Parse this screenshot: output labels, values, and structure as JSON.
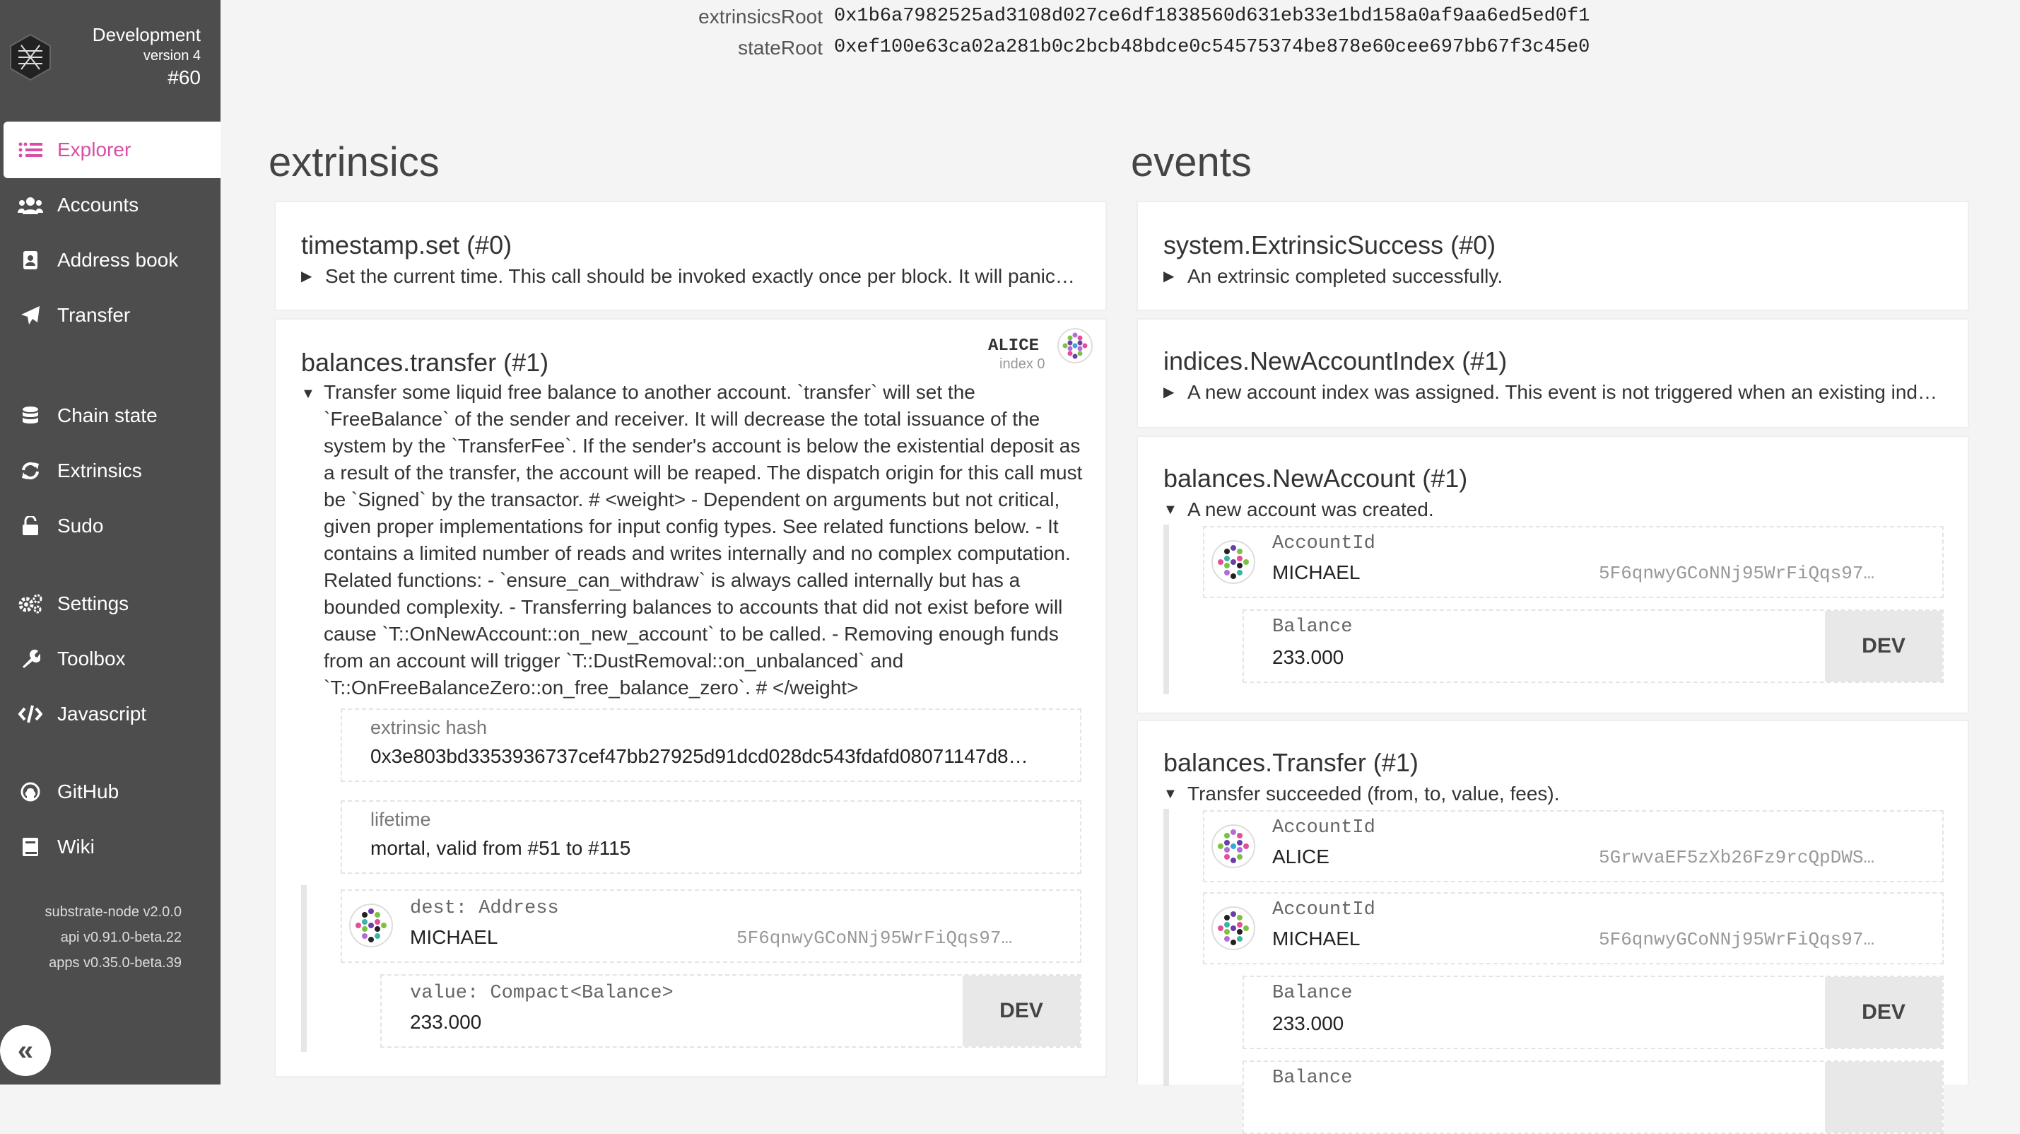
{
  "chain": {
    "name": "Development",
    "version": "version 4",
    "block": "#60"
  },
  "nav": [
    {
      "label": "Explorer",
      "icon": "explorer-grid-icon",
      "active": true
    },
    {
      "label": "Accounts",
      "icon": "users-icon"
    },
    {
      "label": "Address book",
      "icon": "address-book-icon"
    },
    {
      "label": "Transfer",
      "icon": "paper-plane-icon"
    },
    {
      "label": "Chain state",
      "icon": "database-icon"
    },
    {
      "label": "Extrinsics",
      "icon": "sync-icon"
    },
    {
      "label": "Sudo",
      "icon": "unlock-icon"
    },
    {
      "label": "Settings",
      "icon": "gears-icon"
    },
    {
      "label": "Toolbox",
      "icon": "wrench-icon"
    },
    {
      "label": "Javascript",
      "icon": "code-icon"
    },
    {
      "label": "GitHub",
      "icon": "github-icon"
    },
    {
      "label": "Wiki",
      "icon": "book-icon"
    }
  ],
  "versions": [
    "substrate-node v2.0.0",
    "api v0.91.0-beta.22",
    "apps v0.35.0-beta.39"
  ],
  "roots": {
    "extrinsics_label": "extrinsicsRoot",
    "extrinsics_value": "0x1b6a7982525ad3108d027ce6df1838560d631eb33e1bd158a0af9aa6ed5ed0f1",
    "state_label": "stateRoot",
    "state_value": "0xef100e63ca02a281b0c2bcb48bdce0c54575374be878e60cee697bb67f3c45e0"
  },
  "extrinsics": {
    "title": "extrinsics",
    "timestamp": {
      "title": "timestamp.set (#0)",
      "desc": "Set the current time. This call should be invoked exactly once per block. It will panic…"
    },
    "transfer": {
      "title": "balances.transfer (#1)",
      "signer_name": "ALICE",
      "signer_index": "index 0",
      "desc": "Transfer some liquid free balance to another account. `transfer` will set the `FreeBalance` of the sender and receiver. It will decrease the total issuance of the system by the `TransferFee`. If the sender's account is below the existential deposit as a result of the transfer, the account will be reaped. The dispatch origin for this call must be `Signed` by the transactor. # <weight> - Dependent on arguments but not critical, given proper implementations for input config types. See related functions below. - It contains a limited number of reads and writes internally and no complex computation. Related functions: - `ensure_can_withdraw` is always called internally but has a bounded complexity. - Transferring balances to accounts that did not exist before will cause `T::OnNewAccount::on_new_account` to be called. - Removing enough funds from an account will trigger `T::DustRemoval::on_unbalanced` and `T::OnFreeBalanceZero::on_free_balance_zero`. # </weight>",
      "hash_label": "extrinsic hash",
      "hash_value": "0x3e803bd3353936737cef47bb27925d91dcd028dc543fdafd08071147d8…",
      "lifetime_label": "lifetime",
      "lifetime_value": "mortal, valid from #51 to #115",
      "dest_label": "dest: Address",
      "dest_name": "MICHAEL",
      "dest_addr": "5F6qnwyGCoNNj95WrFiQqs97…",
      "value_label": "value: Compact<Balance>",
      "value_value": "233.000",
      "value_unit": "DEV"
    }
  },
  "events": {
    "title": "events",
    "success": {
      "title": "system.ExtrinsicSuccess (#0)",
      "desc": "An extrinsic completed successfully."
    },
    "newindex": {
      "title": "indices.NewAccountIndex (#1)",
      "desc": "A new account index was assigned. This event is not triggered when an existing ind…"
    },
    "newaccount": {
      "title": "balances.NewAccount (#1)",
      "desc": "A new account was created.",
      "acct_label": "AccountId",
      "acct_name": "MICHAEL",
      "acct_addr": "5F6qnwyGCoNNj95WrFiQqs97…",
      "bal_label": "Balance",
      "bal_value": "233.000",
      "bal_unit": "DEV"
    },
    "transfer": {
      "title": "balances.Transfer (#1)",
      "desc": "Transfer succeeded (from, to, value, fees).",
      "from_label": "AccountId",
      "from_name": "ALICE",
      "from_addr": "5GrwvaEF5zXb26Fz9rcQpDWS…",
      "to_label": "AccountId",
      "to_name": "MICHAEL",
      "to_addr": "5F6qnwyGCoNNj95WrFiQqs97…",
      "bal_label": "Balance",
      "bal_value": "233.000",
      "bal_unit": "DEV",
      "bal2_label": "Balance"
    }
  }
}
